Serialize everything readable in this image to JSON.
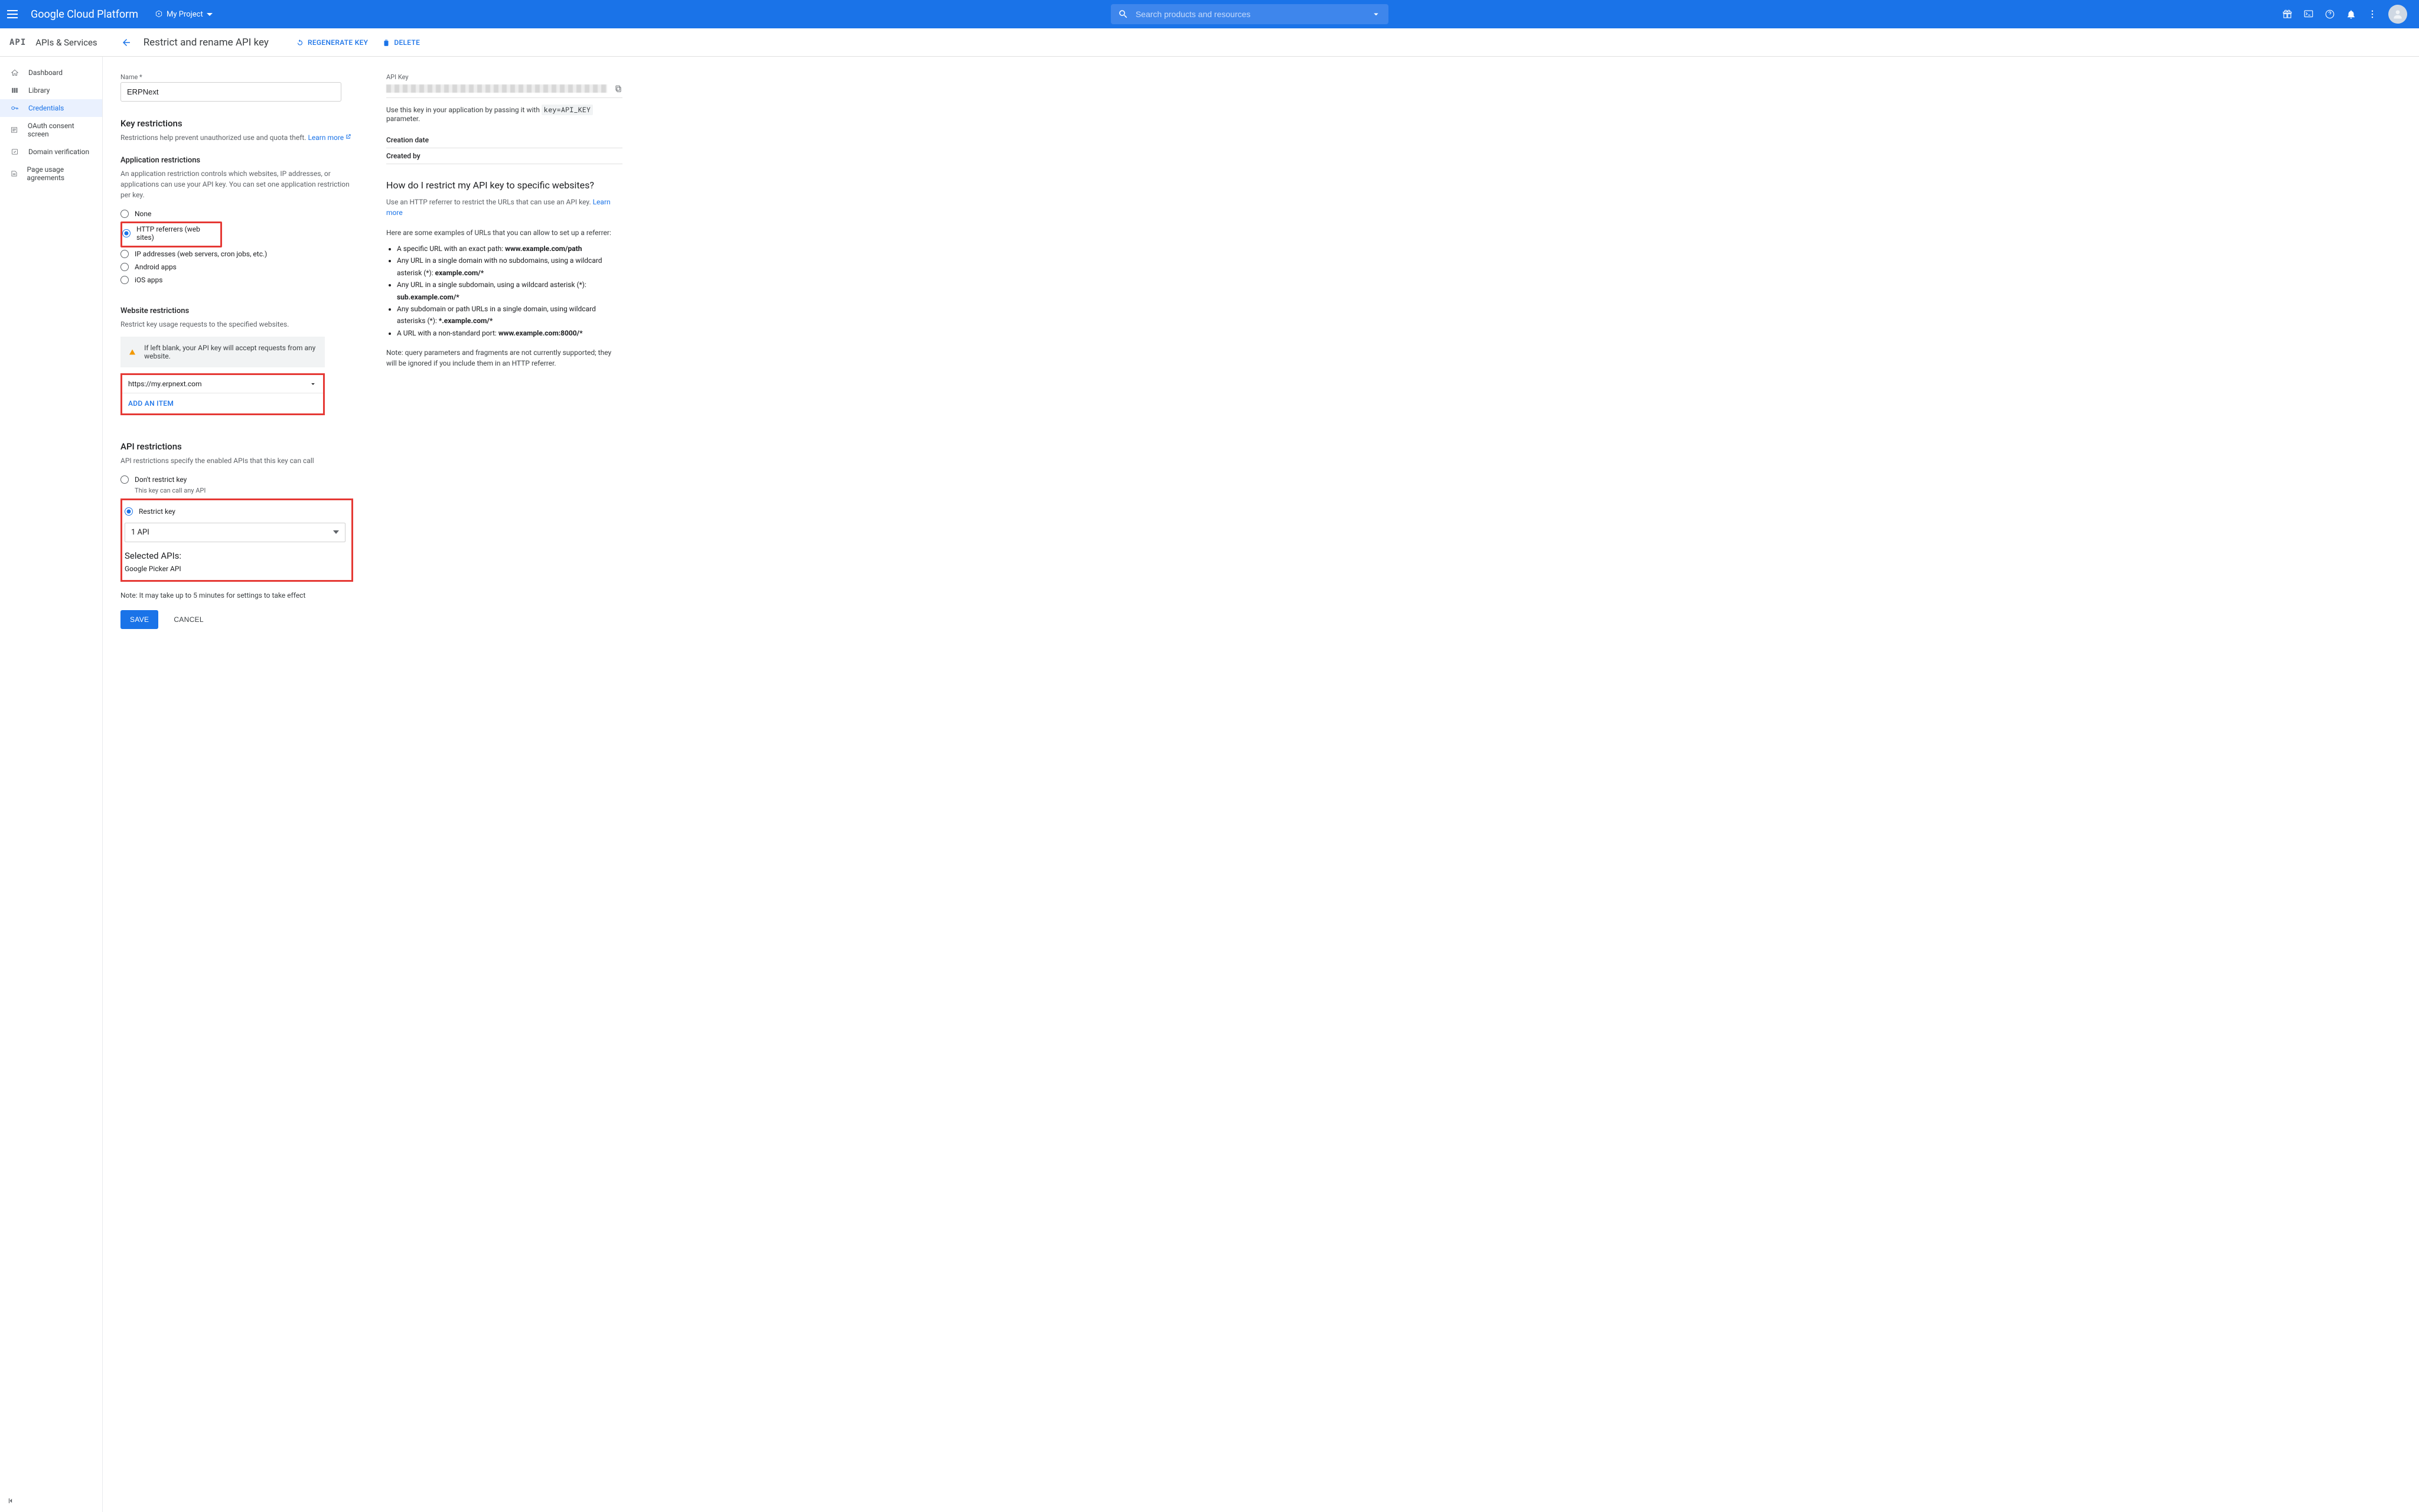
{
  "topbar": {
    "brand": "Google Cloud Platform",
    "project": "My Project",
    "search_placeholder": "Search products and resources"
  },
  "subhead": {
    "api_logo": "API",
    "section_title": "APIs & Services",
    "page_title": "Restrict and rename API key",
    "regenerate": "REGENERATE KEY",
    "delete": "DELETE"
  },
  "sidebar": {
    "items": [
      {
        "label": "Dashboard"
      },
      {
        "label": "Library"
      },
      {
        "label": "Credentials"
      },
      {
        "label": "OAuth consent screen"
      },
      {
        "label": "Domain verification"
      },
      {
        "label": "Page usage agreements"
      }
    ]
  },
  "form": {
    "name_label": "Name *",
    "name_value": "ERPNext",
    "key_restrictions": "Key restrictions",
    "key_restrictions_help": "Restrictions help prevent unauthorized use and quota theft. ",
    "learn_more": "Learn more",
    "app_restrictions": "Application restrictions",
    "app_restrictions_help": "An application restriction controls which websites, IP addresses, or applications can use your API key. You can set one application restriction per key.",
    "radios": {
      "none": "None",
      "http": "HTTP referrers (web sites)",
      "ip": "IP addresses (web servers, cron jobs, etc.)",
      "android": "Android apps",
      "ios": "iOS apps"
    },
    "website_restrictions": "Website restrictions",
    "website_restrictions_help": "Restrict key usage requests to the specified websites.",
    "blank_warn": "If left blank, your API key will accept requests from any website.",
    "referrer": "https://my.erpnext.com",
    "add_item": "ADD AN ITEM",
    "api_restrictions": "API restrictions",
    "api_restrictions_help": "API restrictions specify the enabled APIs that this key can call",
    "dont_restrict": "Don't restrict key",
    "dont_restrict_sub": "This key can call any API",
    "restrict": "Restrict key",
    "api_select": "1 API",
    "selected_apis": "Selected APIs:",
    "selected_api_1": "Google Picker API",
    "note": "Note: It may take up to 5 minutes for settings to take effect",
    "save": "SAVE",
    "cancel": "CANCEL"
  },
  "right": {
    "api_key_label": "API Key",
    "pass_pre": "Use this key in your application by passing it with ",
    "pass_code": "key=API_KEY",
    "pass_post": " parameter.",
    "creation_date": "Creation date",
    "created_by": "Created by",
    "howto_title": "How do I restrict my API key to specific websites?",
    "howto_text": "Use an HTTP referrer to restrict the URLs that can use an API key. ",
    "examples_intro": "Here are some examples of URLs that you can allow to set up a referrer:",
    "ex1_a": "A specific URL with an exact path: ",
    "ex1_b": "www.example.com/path",
    "ex2_a": "Any URL in a single domain with no subdomains, using a wildcard asterisk (*): ",
    "ex2_b": "example.com/*",
    "ex3_a": "Any URL in a single subdomain, using a wildcard asterisk (*): ",
    "ex3_b": "sub.example.com/*",
    "ex4_a": "Any subdomain or path URLs in a single domain, using wildcard asterisks (*): ",
    "ex4_b": "*.example.com/*",
    "ex5_a": "A URL with a non-standard port: ",
    "ex5_b": "www.example.com:8000/*",
    "note": "Note: query parameters and fragments are not currently supported; they will be ignored if you include them in an HTTP referrer."
  }
}
